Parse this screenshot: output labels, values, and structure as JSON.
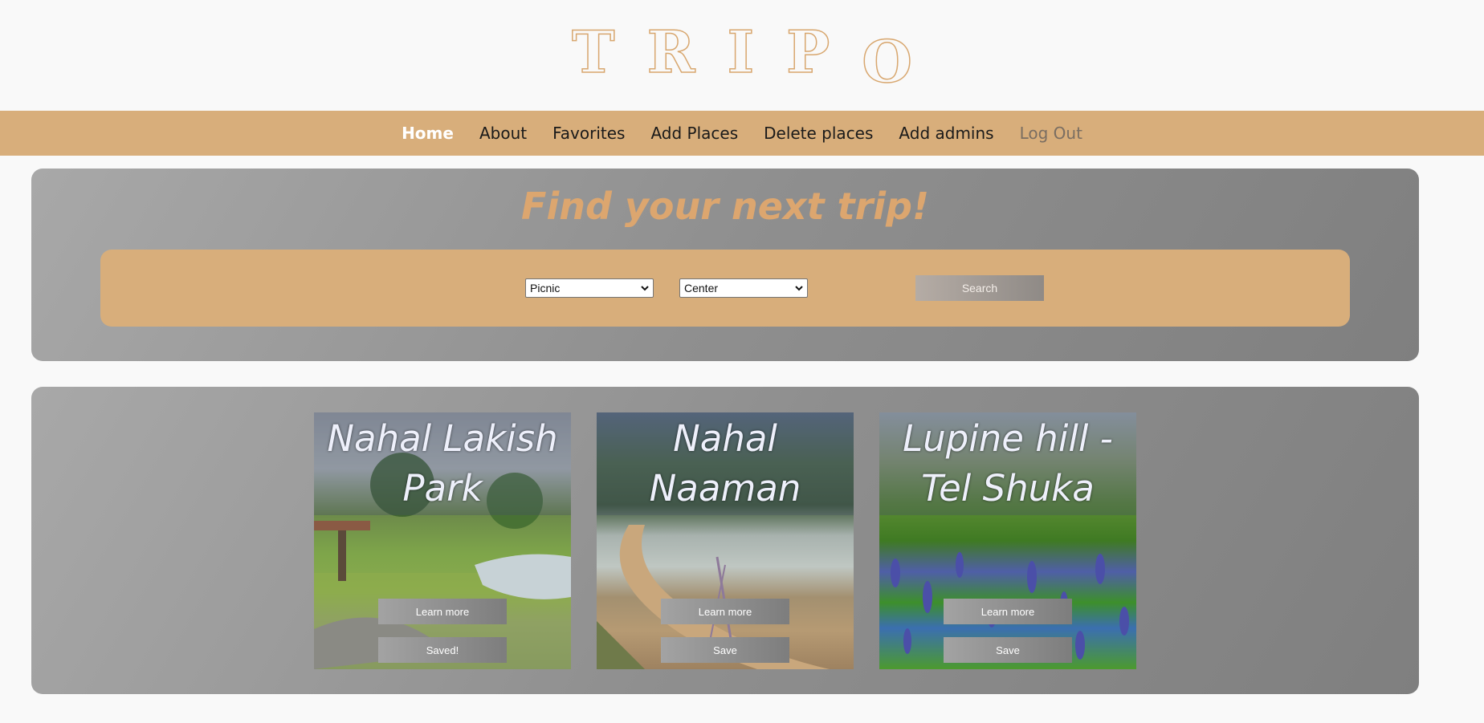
{
  "logo": {
    "letters": [
      "T",
      "R",
      "I",
      "P",
      "O"
    ]
  },
  "nav": {
    "items": [
      {
        "label": "Home"
      },
      {
        "label": "About"
      },
      {
        "label": "Favorites"
      },
      {
        "label": "Add Places"
      },
      {
        "label": "Delete places"
      },
      {
        "label": "Add admins"
      },
      {
        "label": "Log Out"
      }
    ]
  },
  "search": {
    "title": "Find your next trip!",
    "type_select": {
      "value": "Picnic"
    },
    "region_select": {
      "value": "Center"
    },
    "button_label": "Search"
  },
  "results": {
    "cards": [
      {
        "title": "Nahal Lakish Park",
        "learn_label": "Learn more",
        "save_label": "Saved!"
      },
      {
        "title": "Nahal Naaman",
        "learn_label": "Learn more",
        "save_label": "Save"
      },
      {
        "title": "Lupine hill - Tel Shuka",
        "learn_label": "Learn more",
        "save_label": "Save"
      }
    ]
  },
  "colors": {
    "accent": "#d8ae7b",
    "title": "#dca66f",
    "background": "#f9f9f9"
  }
}
